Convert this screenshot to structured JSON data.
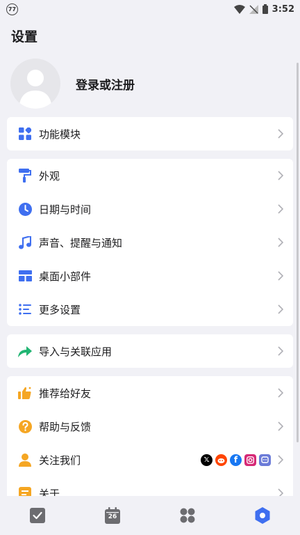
{
  "status_bar": {
    "badge": "77",
    "time": "3:52"
  },
  "page_title": "设置",
  "profile": {
    "label": "登录或注册"
  },
  "groups": [
    {
      "items": [
        {
          "icon": "modules-icon",
          "label": "功能模块"
        }
      ]
    },
    {
      "items": [
        {
          "icon": "paint-roller-icon",
          "label": "外观"
        },
        {
          "icon": "clock-icon",
          "label": "日期与时间"
        },
        {
          "icon": "music-note-icon",
          "label": "声音、提醒与通知"
        },
        {
          "icon": "widgets-icon",
          "label": "桌面小部件"
        },
        {
          "icon": "list-settings-icon",
          "label": "更多设置"
        }
      ]
    },
    {
      "items": [
        {
          "icon": "share-arrow-icon",
          "label": "导入与关联应用"
        }
      ]
    },
    {
      "items": [
        {
          "icon": "thumbs-up-icon",
          "label": "推荐给好友"
        },
        {
          "icon": "help-icon",
          "label": "帮助与反馈"
        },
        {
          "icon": "person-icon",
          "label": "关注我们"
        },
        {
          "icon": "about-icon",
          "label": "关于"
        }
      ]
    }
  ],
  "socials": [
    {
      "name": "x",
      "glyph": "𝕏",
      "color": "#000000"
    },
    {
      "name": "reddit",
      "glyph": "●",
      "color": "#ff4500"
    },
    {
      "name": "facebook",
      "glyph": "f",
      "color": "#1877f2"
    },
    {
      "name": "instagram",
      "glyph": "◎",
      "color": "#d62976"
    },
    {
      "name": "discord",
      "glyph": "▣",
      "color": "#6b7bd8"
    }
  ],
  "bottom_nav": {
    "calendar_day": "26",
    "active_tab": "settings"
  },
  "colors": {
    "accent": "#3f6ff0",
    "green": "#22b573",
    "orange": "#f5a623",
    "chevron": "#b0b0b6"
  }
}
